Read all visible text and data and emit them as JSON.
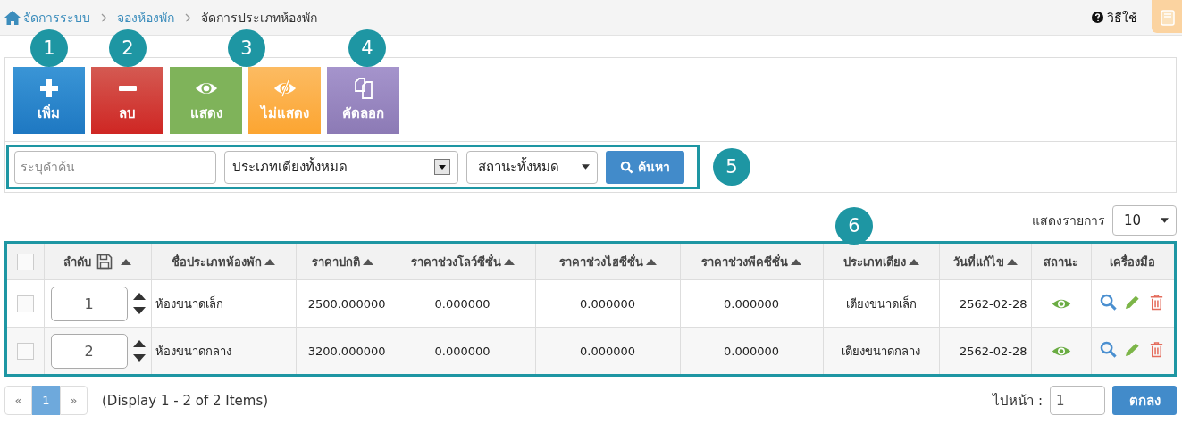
{
  "breadcrumb": [
    {
      "label": "จัดการระบบ",
      "kind": "home"
    },
    {
      "label": "จองห้องพัก",
      "kind": "link"
    },
    {
      "label": "จัดการประเภทห้องพัก",
      "kind": "current"
    }
  ],
  "help": {
    "label": "วิธีใช้"
  },
  "toolbar": [
    {
      "label": "เพิ่ม",
      "kind": "add"
    },
    {
      "label": "ลบ",
      "kind": "delete"
    },
    {
      "label": "แสดง",
      "kind": "show"
    },
    {
      "label": "ไม่แสดง",
      "kind": "hide"
    },
    {
      "label": "คัดลอก",
      "kind": "copy"
    }
  ],
  "search": {
    "placeholder": "ระบุคำค้น",
    "bed_type": "ประเภทเตียงทั้งหมด",
    "status": "สถานะทั้งหมด",
    "button": "ค้นหา"
  },
  "page_size": {
    "label": "แสดงรายการ",
    "value": "10"
  },
  "table": {
    "select_all": {
      "checked": false
    },
    "columns": [
      {
        "label": "ลำดับ",
        "sortable": true,
        "save": true
      },
      {
        "label": "ชื่อประเภทห้องพัก",
        "sortable": true,
        "save": false
      },
      {
        "label": "ราคาปกติ",
        "sortable": true,
        "save": false
      },
      {
        "label": "ราคาช่วงโลว์ซีซั่น",
        "sortable": true,
        "save": false
      },
      {
        "label": "ราคาช่วงไฮซีซั่น",
        "sortable": true,
        "save": false
      },
      {
        "label": "ราคาช่วงพีคซีซั่น",
        "sortable": true,
        "save": false
      },
      {
        "label": "ประเภทเตียง",
        "sortable": true,
        "save": false
      },
      {
        "label": "วันที่แก้ไข",
        "sortable": true,
        "save": false
      },
      {
        "label": "สถานะ",
        "sortable": false,
        "save": false
      },
      {
        "label": "เครื่องมือ",
        "sortable": false,
        "save": false
      }
    ],
    "rows": [
      {
        "checked": false,
        "order": "1",
        "name": "ห้องขนาดเล็ก",
        "price": "2500.000000",
        "low": "0.000000",
        "high": "0.000000",
        "peak": "0.000000",
        "bed": "เตียงขนาดเล็ก",
        "date": "2562-02-28",
        "visible": true
      },
      {
        "checked": false,
        "order": "2",
        "name": "ห้องขนาดกลาง",
        "price": "3200.000000",
        "low": "0.000000",
        "high": "0.000000",
        "peak": "0.000000",
        "bed": "เตียงขนาดกลาง",
        "date": "2562-02-28",
        "visible": true
      }
    ]
  },
  "pagination": {
    "prev": "«",
    "pages": [
      {
        "label": "1",
        "selected": true
      }
    ],
    "next": "»",
    "summary": "(Display 1 - 2 of 2 Items)",
    "goto_label": "ไปหน้า :",
    "goto_value": "1",
    "go_button": "ตกลง"
  },
  "markers": [
    "1",
    "2",
    "3",
    "4",
    "5",
    "6"
  ]
}
